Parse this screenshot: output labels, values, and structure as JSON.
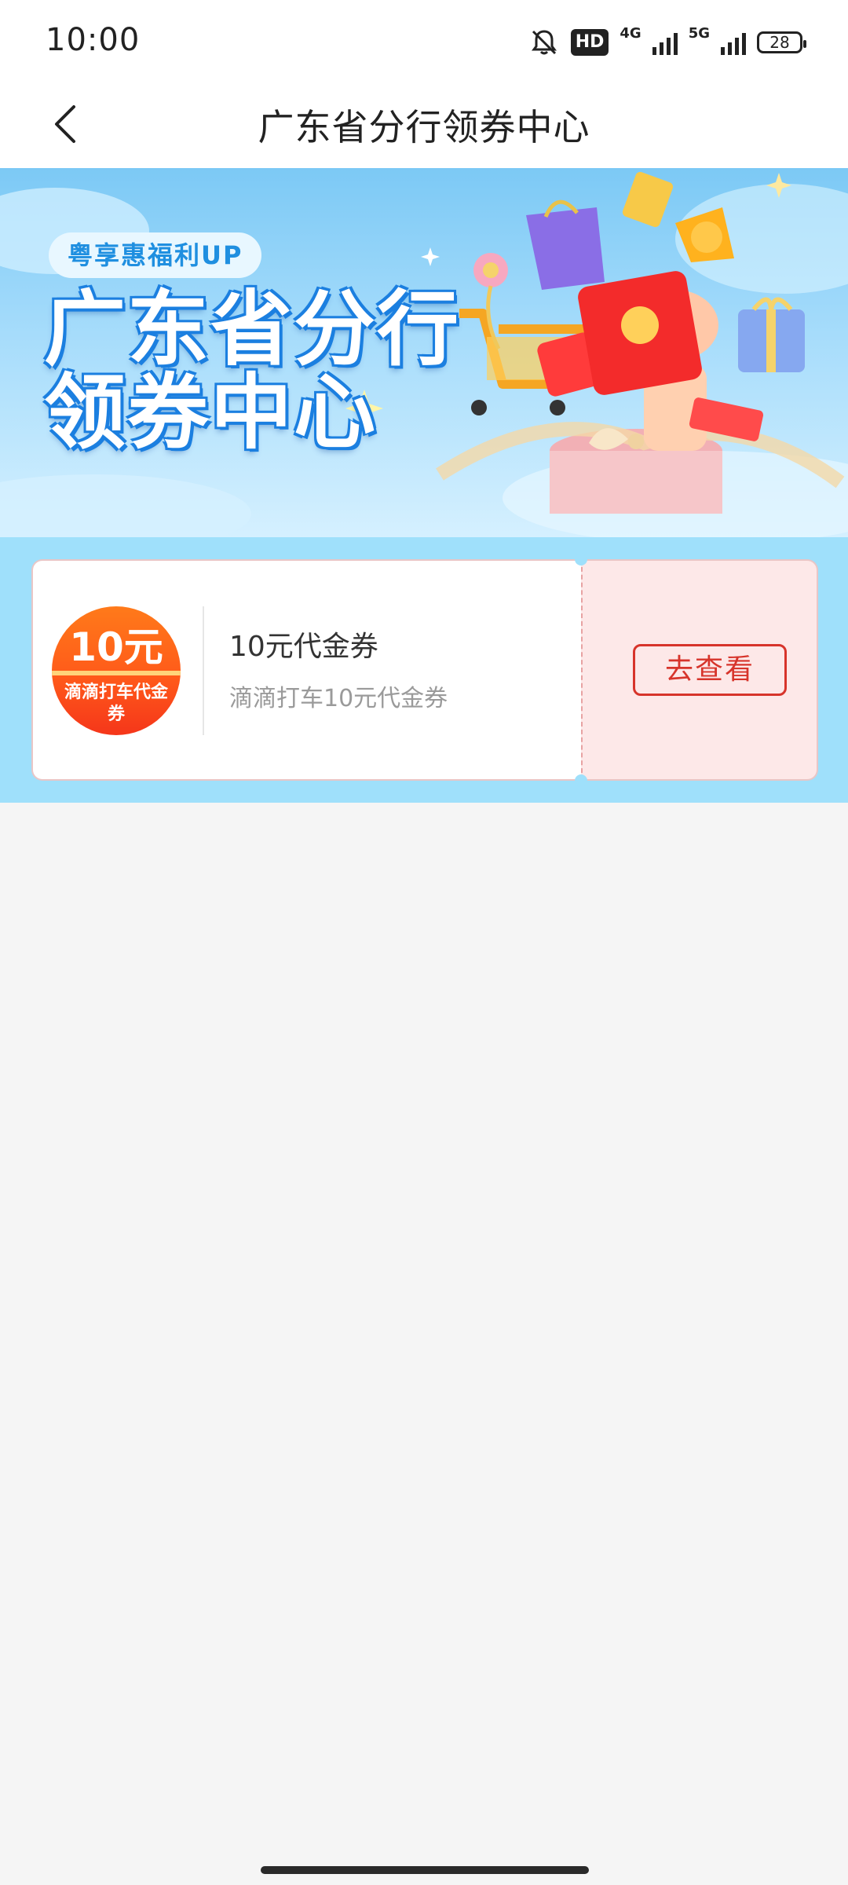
{
  "status_bar": {
    "time": "10:00",
    "hd_label": "HD",
    "net1": "4G",
    "net2": "5G",
    "battery": "28"
  },
  "nav": {
    "title": "广东省分行领券中心",
    "back_icon": "chevron-left-icon"
  },
  "banner": {
    "tag": "粤享惠福利UP",
    "title_line1": "广东省分行",
    "title_line2": "领券中心"
  },
  "coupons": [
    {
      "badge_amount": "10元",
      "badge_desc": "滴滴打车代金券",
      "name": "10元代金券",
      "subtitle": "滴滴打车10元代金券",
      "action_label": "去查看"
    }
  ],
  "colors": {
    "accent_red": "#d7342b",
    "coupon_area_bg": "#9fe0fb",
    "page_bg": "#f5f5f5"
  }
}
